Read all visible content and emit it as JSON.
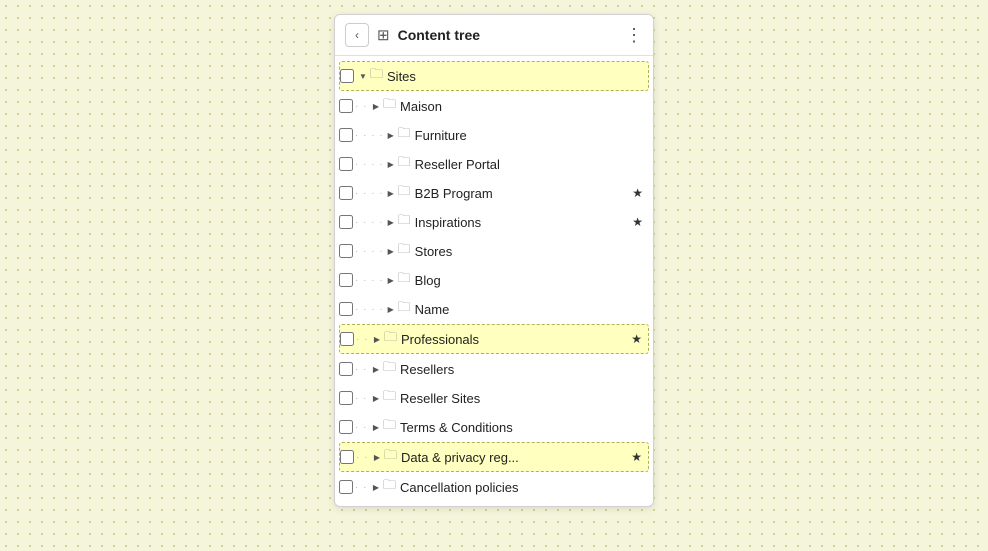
{
  "header": {
    "back_label": "‹",
    "icon": "⊞",
    "title": "Content tree",
    "more_icon": "⋮"
  },
  "tree": {
    "items": [
      {
        "id": "sites",
        "level": 0,
        "label": "Sites",
        "expanded": true,
        "has_star": false,
        "highlighted": true,
        "arrow": "▼"
      },
      {
        "id": "maison",
        "level": 1,
        "label": "Maison",
        "expanded": true,
        "has_star": false,
        "highlighted": false,
        "arrow": "▶"
      },
      {
        "id": "furniture",
        "level": 2,
        "label": "Furniture",
        "expanded": false,
        "has_star": false,
        "highlighted": false,
        "arrow": "▶"
      },
      {
        "id": "reseller-portal",
        "level": 2,
        "label": "Reseller Portal",
        "expanded": false,
        "has_star": false,
        "highlighted": false,
        "arrow": "▶"
      },
      {
        "id": "b2b-program",
        "level": 2,
        "label": "B2B Program",
        "expanded": false,
        "has_star": true,
        "highlighted": false,
        "arrow": "▶"
      },
      {
        "id": "inspirations",
        "level": 2,
        "label": "Inspirations",
        "expanded": false,
        "has_star": true,
        "highlighted": false,
        "arrow": "▶"
      },
      {
        "id": "stores",
        "level": 2,
        "label": "Stores",
        "expanded": false,
        "has_star": false,
        "highlighted": false,
        "arrow": "▶"
      },
      {
        "id": "blog",
        "level": 2,
        "label": "Blog",
        "expanded": false,
        "has_star": false,
        "highlighted": false,
        "arrow": "▶"
      },
      {
        "id": "name",
        "level": 2,
        "label": "Name",
        "expanded": false,
        "has_star": false,
        "highlighted": false,
        "arrow": "▶"
      },
      {
        "id": "professionals",
        "level": 1,
        "label": "Professionals",
        "expanded": false,
        "has_star": true,
        "highlighted": true,
        "arrow": "▶"
      },
      {
        "id": "resellers",
        "level": 1,
        "label": "Resellers",
        "expanded": false,
        "has_star": false,
        "highlighted": false,
        "arrow": "▶"
      },
      {
        "id": "reseller-sites",
        "level": 1,
        "label": "Reseller Sites",
        "expanded": false,
        "has_star": false,
        "highlighted": false,
        "arrow": "▶"
      },
      {
        "id": "terms-conditions",
        "level": 1,
        "label": "Terms & Conditions",
        "expanded": false,
        "has_star": false,
        "highlighted": false,
        "arrow": "▶"
      },
      {
        "id": "data-privacy",
        "level": 1,
        "label": "Data & privacy reg...",
        "expanded": false,
        "has_star": true,
        "highlighted": true,
        "arrow": "▶"
      },
      {
        "id": "cancellation",
        "level": 1,
        "label": "Cancellation policies",
        "expanded": false,
        "has_star": false,
        "highlighted": false,
        "arrow": "▶"
      }
    ]
  },
  "icons": {
    "star": "★",
    "folder": "🗂",
    "arrow_right": "▶",
    "arrow_down": "▼"
  }
}
